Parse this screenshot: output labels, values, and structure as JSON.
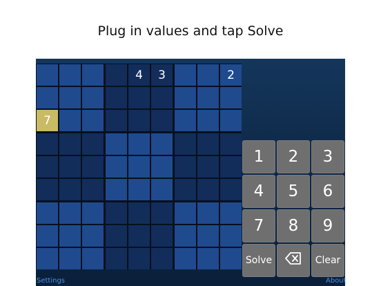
{
  "heading": "Plug in values and tap Solve",
  "grid": {
    "cells": [
      [
        "",
        "",
        "",
        "",
        "4",
        "3",
        "",
        "",
        "2"
      ],
      [
        "",
        "",
        "",
        "",
        "",
        "",
        "",
        "",
        ""
      ],
      [
        "7",
        "",
        "",
        "",
        "",
        "",
        "",
        "",
        ""
      ],
      [
        "",
        "",
        "",
        "",
        "",
        "",
        "",
        "",
        ""
      ],
      [
        "",
        "",
        "",
        "",
        "",
        "",
        "",
        "",
        ""
      ],
      [
        "",
        "",
        "",
        "",
        "",
        "",
        "",
        "",
        ""
      ],
      [
        "",
        "",
        "",
        "",
        "",
        "",
        "",
        "",
        ""
      ],
      [
        "",
        "",
        "",
        "",
        "",
        "",
        "",
        "",
        ""
      ],
      [
        "",
        "",
        "",
        "",
        "",
        "",
        "",
        "",
        ""
      ]
    ],
    "selected": [
      2,
      0
    ]
  },
  "keypad": {
    "keys": [
      {
        "label": "1",
        "name": "key-1"
      },
      {
        "label": "2",
        "name": "key-2"
      },
      {
        "label": "3",
        "name": "key-3"
      },
      {
        "label": "4",
        "name": "key-4"
      },
      {
        "label": "5",
        "name": "key-5"
      },
      {
        "label": "6",
        "name": "key-6"
      },
      {
        "label": "7",
        "name": "key-7"
      },
      {
        "label": "8",
        "name": "key-8"
      },
      {
        "label": "9",
        "name": "key-9"
      },
      {
        "label": "Solve",
        "name": "solve-button"
      },
      {
        "label": "",
        "name": "delete-button",
        "icon": "backspace-icon"
      },
      {
        "label": "Clear",
        "name": "clear-button"
      }
    ]
  },
  "footer": {
    "settings": "Settings",
    "about": "About"
  },
  "colors": {
    "cell_light": "#1f4a8e",
    "cell_dark": "#122d5a",
    "selected": "#c9ba64",
    "key": "#6f6f6f",
    "link": "#4b8fe0"
  }
}
